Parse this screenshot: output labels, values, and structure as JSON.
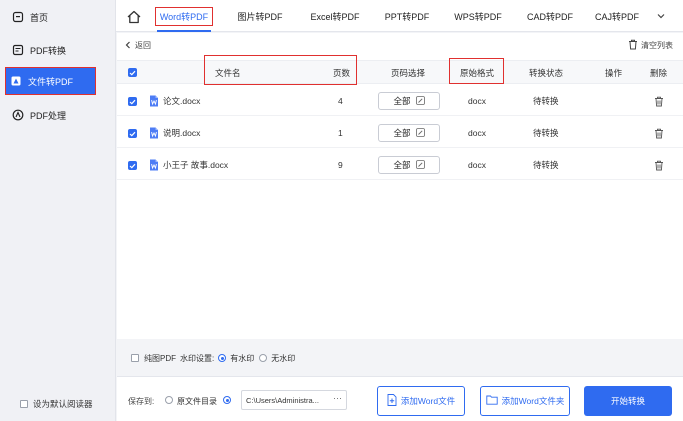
{
  "sidebar": {
    "items": [
      {
        "label": "首页",
        "icon": "home-icon"
      },
      {
        "label": "PDF转换",
        "icon": "pdf-convert-icon"
      },
      {
        "label": "文件转PDF",
        "icon": "file-to-pdf-icon"
      },
      {
        "label": "PDF处理",
        "icon": "pdf-process-icon"
      }
    ],
    "default_reader_label": "设为默认阅读器"
  },
  "tabs": [
    {
      "label": "Word转PDF"
    },
    {
      "label": "图片转PDF"
    },
    {
      "label": "Excel转PDF"
    },
    {
      "label": "PPT转PDF"
    },
    {
      "label": "WPS转PDF"
    },
    {
      "label": "CAD转PDF"
    },
    {
      "label": "CAJ转PDF"
    }
  ],
  "main": {
    "back_label": "返回",
    "clear_label": "清空列表",
    "columns": {
      "filename": "文件名",
      "pages": "页数",
      "page_select": "页码选择",
      "format": "原始格式",
      "status": "转换状态",
      "action": "操作",
      "delete": "删除"
    },
    "rows": [
      {
        "name": "论文.docx",
        "pages": "4",
        "range": "全部",
        "format": "docx",
        "status": "待转换"
      },
      {
        "name": "说明.docx",
        "pages": "1",
        "range": "全部",
        "format": "docx",
        "status": "待转换"
      },
      {
        "name": "小王子 故事.docx",
        "pages": "9",
        "range": "全部",
        "format": "docx",
        "status": "待转换"
      }
    ]
  },
  "watermark": {
    "pure_label": "纯图PDF",
    "setting_label": "水印设置:",
    "with_label": "有水印",
    "without_label": "无水印"
  },
  "bottom": {
    "save_to_label": "保存到:",
    "original_dir_label": "原文件目录",
    "path_value": "C:\\Users\\Administra...",
    "path_more": "···",
    "add_word_label": "添加Word文件",
    "add_folder_label": "添加Word文件夹",
    "start_label": "开始转换"
  },
  "colors": {
    "accent": "#2f6bf0",
    "highlight_box": "#e0302f"
  }
}
